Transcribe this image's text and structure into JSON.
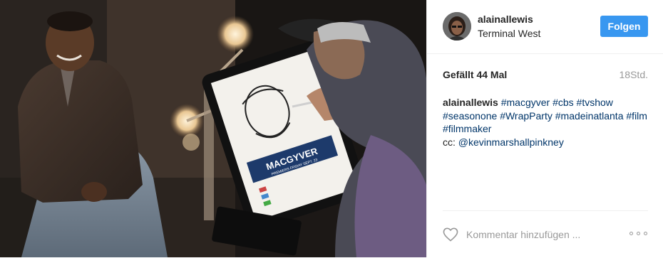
{
  "post": {
    "photo": {
      "tablet_logo_text": "MACGYVER",
      "tablet_subtitle": "PREMIERS FRIDAY SEPT. 23"
    },
    "header": {
      "username": "alainallewis",
      "location": "Terminal West",
      "follow_label": "Folgen"
    },
    "stats": {
      "likes": "Gefällt 44 Mal",
      "time": "18Std."
    },
    "caption": {
      "username": "alainallewis",
      "hashtags": [
        "#macgyver",
        "#cbs",
        "#tvshow",
        "#seasonone",
        "#WrapParty",
        "#madeinatlanta",
        "#film",
        "#filmmaker"
      ],
      "cc_prefix": "cc:",
      "mention": "@kevinmarshallpinkney"
    },
    "comment": {
      "placeholder": "Kommentar hinzufügen ..."
    },
    "icons": {
      "like": "heart-icon",
      "more": "more-options-icon"
    },
    "colors": {
      "accent": "#3897f0",
      "link": "#003569",
      "muted": "#999999",
      "text": "#262626"
    }
  }
}
